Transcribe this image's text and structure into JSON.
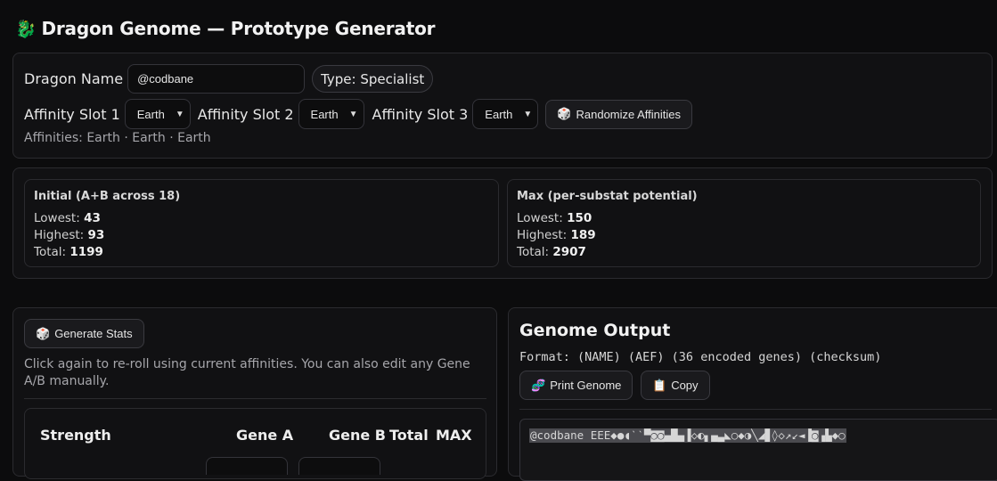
{
  "header": {
    "icon": "dragon-icon",
    "title": "Dragon Genome — Prototype Generator"
  },
  "config": {
    "name_label": "Dragon Name",
    "name_value": "@codbane",
    "type_badge": "Type: Specialist",
    "slots": [
      {
        "label": "Affinity Slot 1",
        "value": "Earth"
      },
      {
        "label": "Affinity Slot 2",
        "value": "Earth"
      },
      {
        "label": "Affinity Slot 3",
        "value": "Earth"
      }
    ],
    "randomize_label": "Randomize Affinities",
    "affinities_text": "Affinities: Earth · Earth · Earth"
  },
  "stats": {
    "initial": {
      "title": "Initial (A+B across 18)",
      "lowest_label": "Lowest:",
      "lowest": "43",
      "highest_label": "Highest:",
      "highest": "93",
      "total_label": "Total:",
      "total": "1199"
    },
    "max": {
      "title": "Max (per-substat potential)",
      "lowest_label": "Lowest:",
      "lowest": "150",
      "highest_label": "Highest:",
      "highest": "189",
      "total_label": "Total:",
      "total": "2907"
    }
  },
  "generator": {
    "generate_label": "Generate Stats",
    "hint": "Click again to re-roll using current affinities. You can also edit any Gene A/B manually.",
    "table_headers": [
      "Strength",
      "Gene A",
      "Gene B",
      "Total",
      "MAX"
    ]
  },
  "output": {
    "title": "Genome Output",
    "format": "Format: (NAME) (AEF) (36 encoded genes) (checksum)",
    "print_label": "Print Genome",
    "copy_label": "Copy",
    "genome_text": "@codbane EEE◆●◖ˋˋ▀◙◙▄█▄▐◇◐▖▄▃◣○◆◑╲◢▊◊◇↗↙◄▐◙▗▙◆○"
  },
  "colors": {
    "background": "#0c0c0d",
    "panel": "#111113",
    "border": "#2b2b2f",
    "text": "#e6e6e6",
    "muted": "#a6a6ab"
  }
}
